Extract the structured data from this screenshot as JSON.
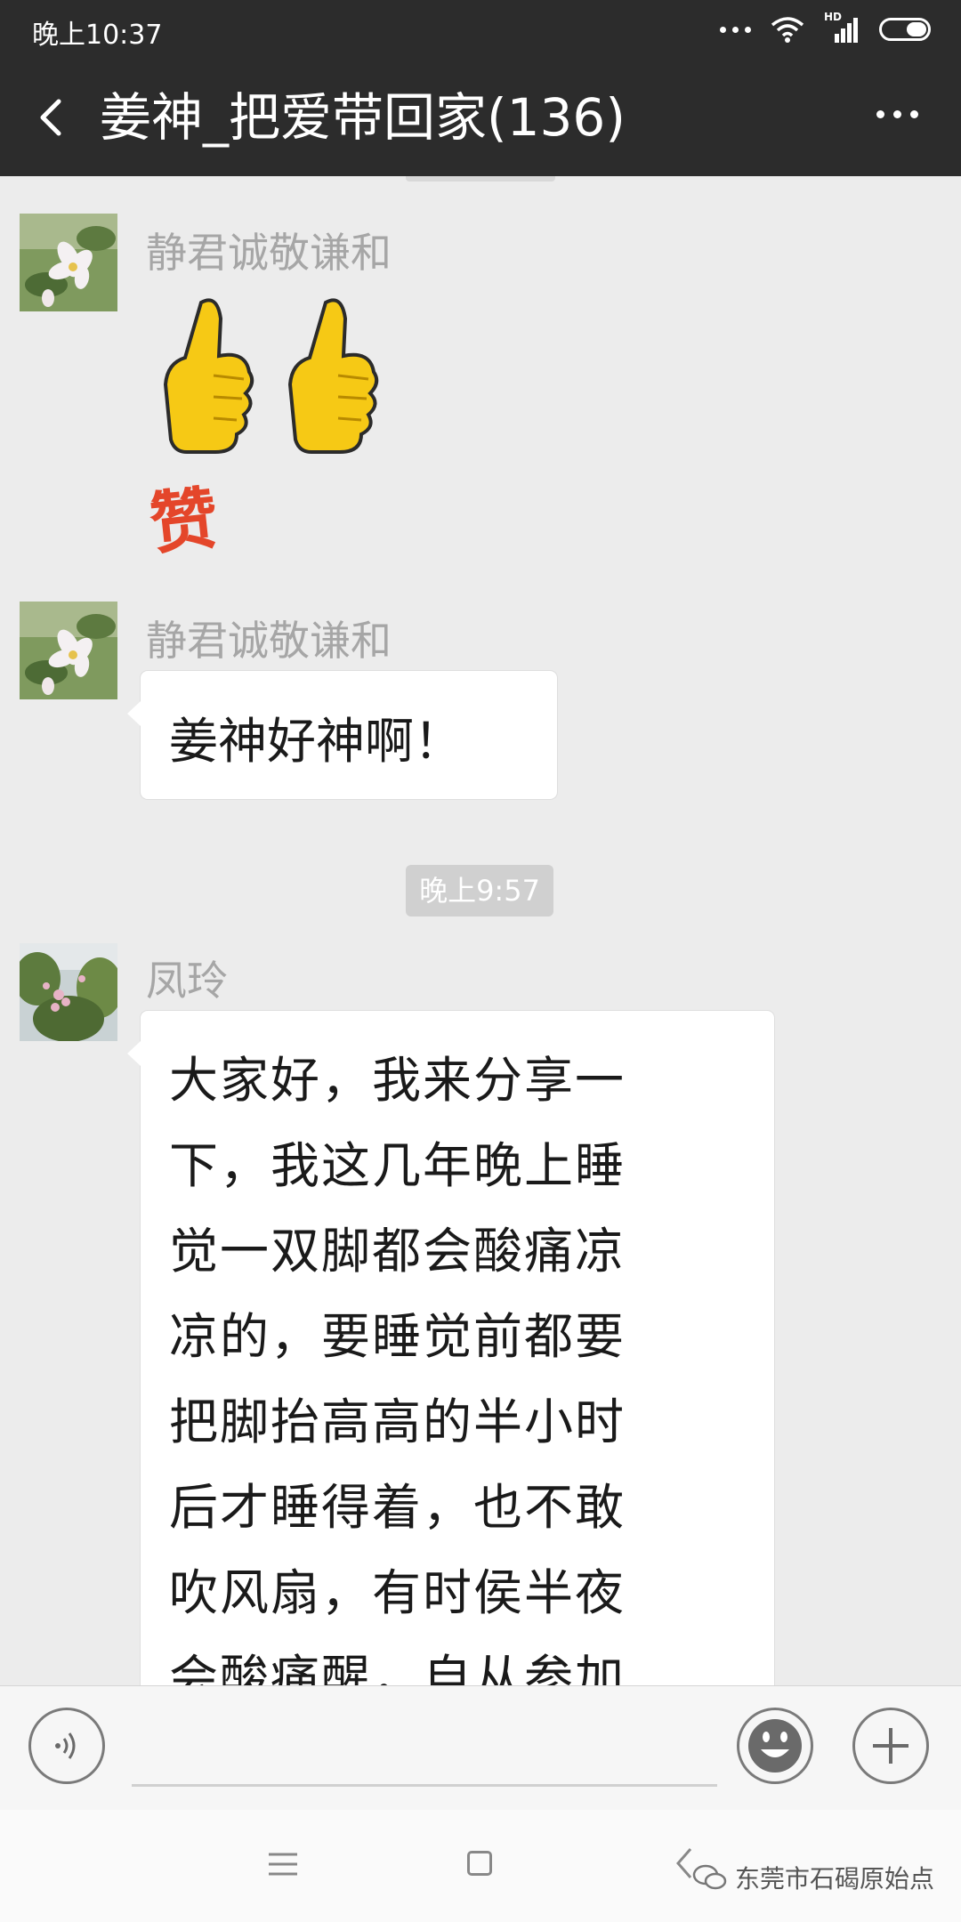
{
  "status_bar": {
    "time": "晚上10:37",
    "network_badge": "HD",
    "icons": [
      "more-dots-icon",
      "wifi-icon",
      "signal-icon",
      "battery-icon"
    ]
  },
  "header": {
    "title": "姜神_把爱带回家(136)",
    "back_icon": "back-chevron-icon",
    "more_icon": "more-dots-icon"
  },
  "messages": [
    {
      "sender": "静君诚敬谦和",
      "type": "sticker",
      "sticker_text": "赞",
      "sticker_icon": "thumbs-up-icon"
    },
    {
      "sender": "静君诚敬谦和",
      "type": "text",
      "text": "姜神好神啊！"
    },
    {
      "type": "timestamp",
      "text": "晚上9:57"
    },
    {
      "sender": "凤玲",
      "type": "text",
      "lines": [
        "大家好，我来分享一",
        "下，我这几年晚上睡",
        "觉一双脚都会酸痛凉",
        "凉的，要睡觉前都要",
        "把脚抬高高的半小时",
        "后才睡得着，也不敢",
        "吹风扇，有时侯半夜",
        "会酸痛醒，自从参加"
      ]
    }
  ],
  "input_bar": {
    "voice_icon": "voice-icon",
    "emoji_icon": "emoji-icon",
    "plus_icon": "plus-icon"
  },
  "nav_bar": {
    "menu_icon": "menu-icon",
    "home_icon": "home-icon",
    "back_icon": "back-icon"
  },
  "watermark": "东莞市石碣原始点",
  "colors": {
    "header_bg": "#2c2c2c",
    "chat_bg": "#ececec",
    "bubble_bg": "#ffffff",
    "sender_text": "#a6a6a6",
    "sticker_red": "#e4462a",
    "thumb_yellow": "#f6c915"
  }
}
